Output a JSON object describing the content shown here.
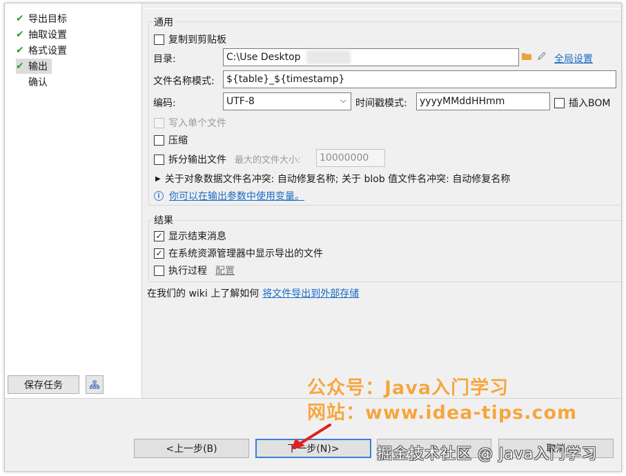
{
  "steps": [
    {
      "label": "导出目标",
      "done": true
    },
    {
      "label": "抽取设置",
      "done": true
    },
    {
      "label": "格式设置",
      "done": true
    },
    {
      "label": "输出",
      "done": true,
      "active": true
    },
    {
      "label": "确认",
      "done": false
    }
  ],
  "left": {
    "save_task_label": "保存任务"
  },
  "general": {
    "title": "通用",
    "copy_to_clipboard": "复制到剪贴板",
    "dir_label": "目录:",
    "dir_value": "C:\\Use          Desktop",
    "global_settings": "全局设置",
    "filename_label": "文件名称模式:",
    "filename_value": "${table}_${timestamp}",
    "encoding_label": "编码:",
    "encoding_value": "UTF-8",
    "timestamp_label": "时间戳模式:",
    "timestamp_value": "yyyyMMddHHmm",
    "insert_bom": "插入BOM",
    "write_single_file": "写入单个文件",
    "compress": "压缩",
    "split_output": "拆分输出文件",
    "max_file_size_label": "最大的文件大小:",
    "max_file_size_value": "10000000",
    "conflict_text": "关于对象数据文件名冲突: 自动修复名称; 关于 blob 值文件名冲突: 自动修复名称",
    "info_link": "你可以在输出参数中使用变量。"
  },
  "results": {
    "title": "结果",
    "show_finish_message": "显示结束消息",
    "show_in_explorer": "在系统资源管理器中显示导出的文件",
    "execute_process": "执行过程",
    "configure": "配置"
  },
  "wiki": {
    "prefix": "在我们的 wiki 上了解如何",
    "link": "将文件导出到外部存储"
  },
  "footer": {
    "back": "<上一步(B)",
    "next": "下一步(N)>",
    "cancel": "取消"
  },
  "watermarks": {
    "wechat": "公众号：Java入门学习",
    "site": "网站：www.idea-tips.com",
    "juejin": "掘金技术社区 @ Java入门学习"
  },
  "colors": {
    "check": "#2e9b3a",
    "link": "#1a6bc4",
    "default_border": "#3c7fd1",
    "watermark": "#f5a640",
    "arrow": "#e02020"
  }
}
